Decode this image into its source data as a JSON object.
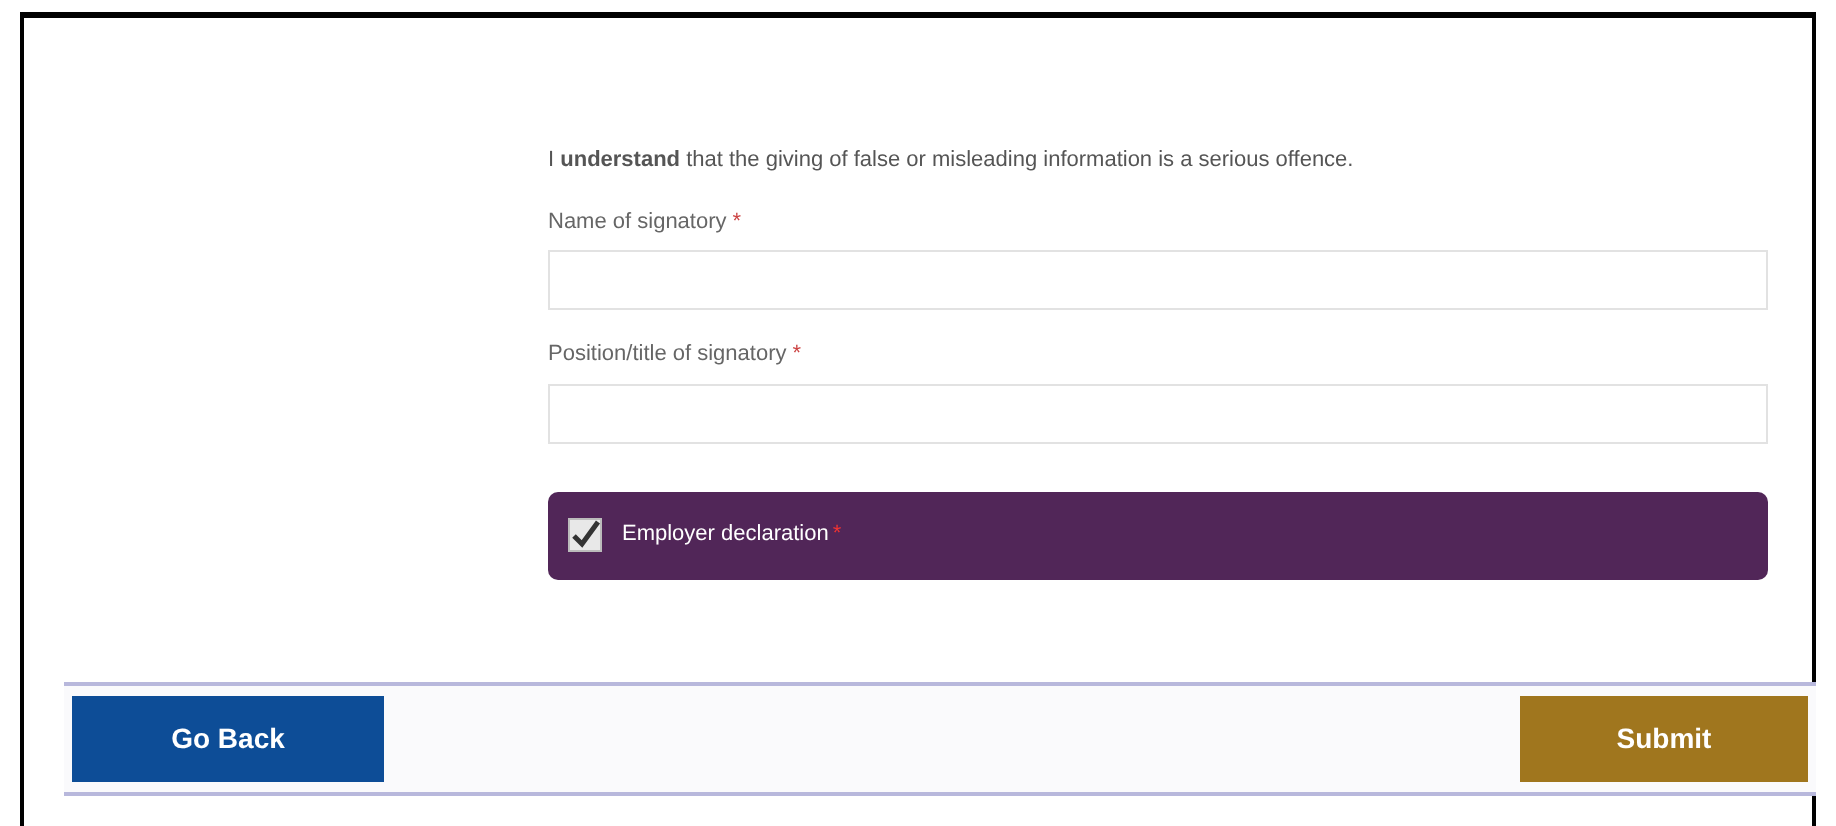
{
  "declaration": {
    "statement": "I **understand** that the giving of false or misleading information is a serious offence.",
    "fields": [
      {
        "label": "Name of signatory",
        "required_mark": "*"
      },
      {
        "label": "Position/title of signatory",
        "required_mark": "*"
      }
    ],
    "confirmation": {
      "label": "Employer declaration",
      "required_mark": "*",
      "checked": true
    }
  },
  "buttons": [
    {
      "label": "Go Back",
      "kind": "back"
    },
    {
      "label": "Submit",
      "kind": "submit"
    }
  ]
}
